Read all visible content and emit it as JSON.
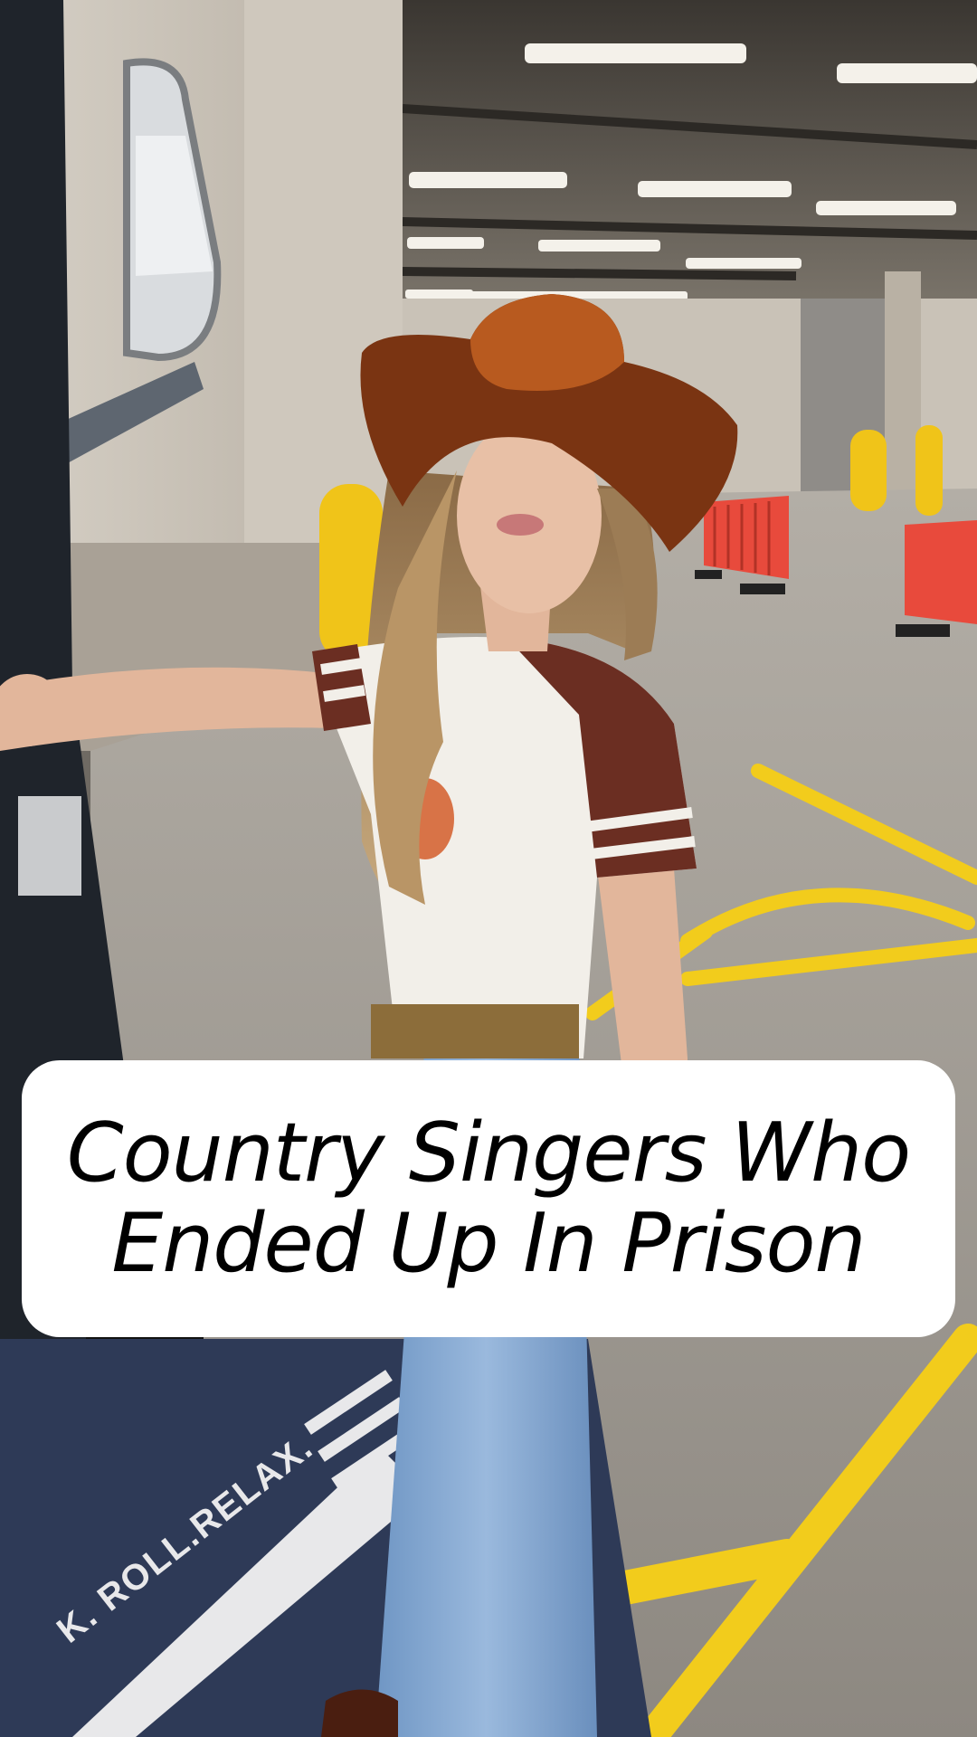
{
  "caption": {
    "line1": "Country Singers Who",
    "line2": "Ended Up In Prison"
  },
  "mat": {
    "text": "K. ROLL.RELAX."
  },
  "colors": {
    "caption_bg": "#ffffff",
    "caption_text": "#000000",
    "hat": "#7a3412",
    "bollard": "#f0c419",
    "lane_paint": "#f2cc1c",
    "barrier": "#e84a3c"
  }
}
